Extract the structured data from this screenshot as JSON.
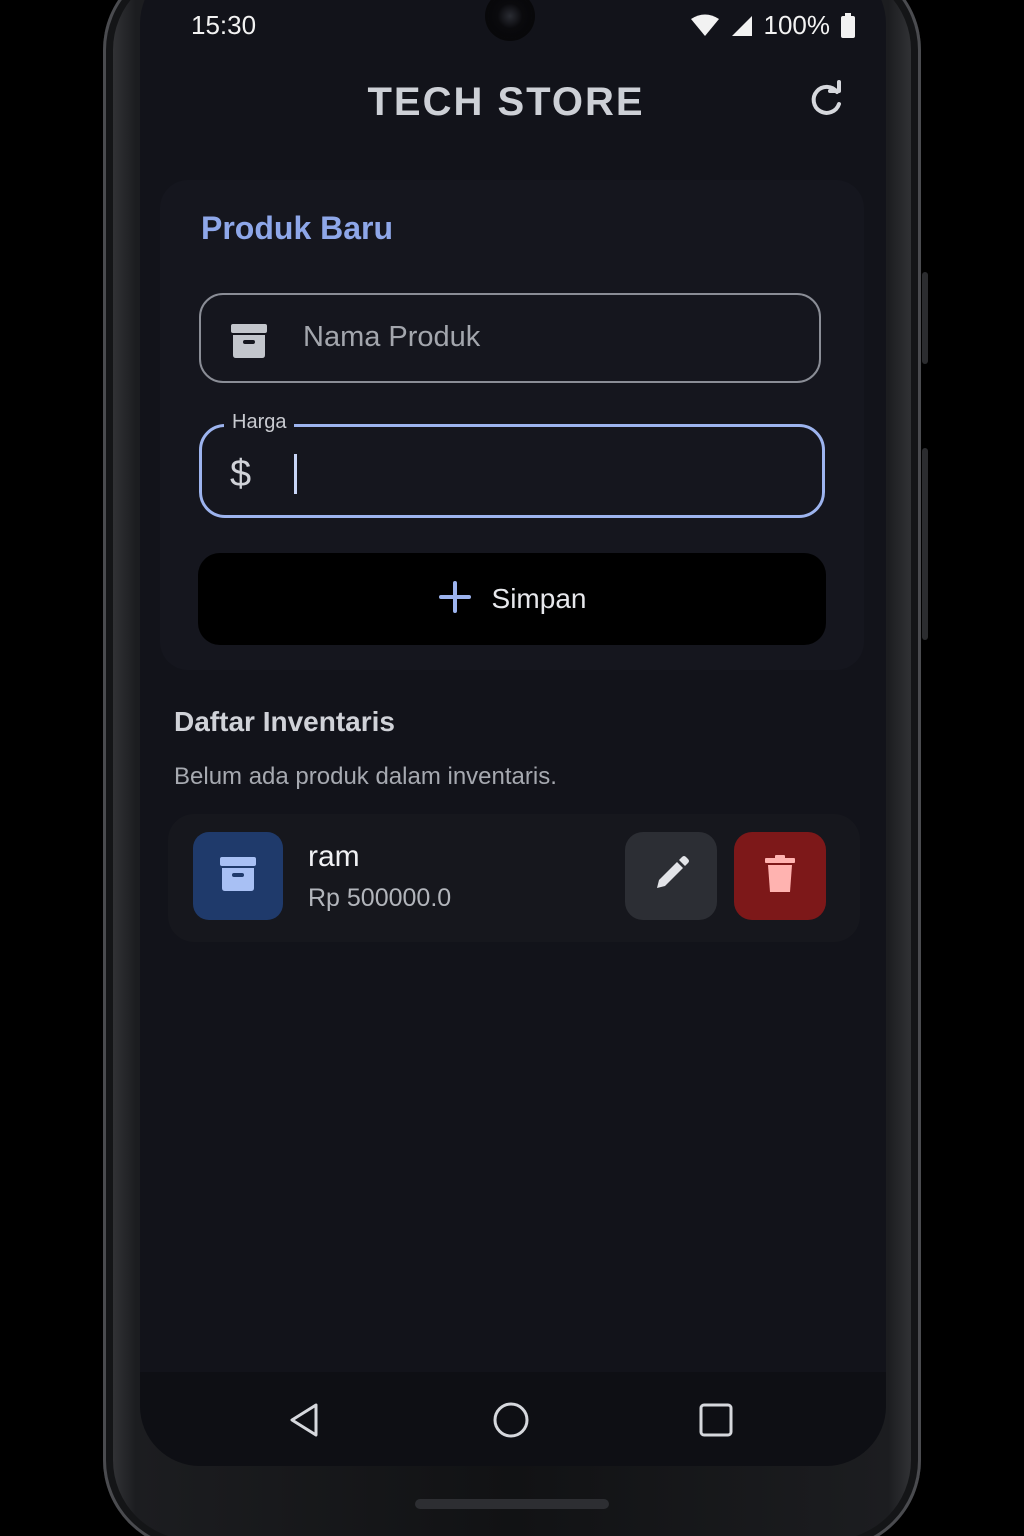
{
  "status_bar": {
    "time": "15:30",
    "battery": "100%"
  },
  "header": {
    "title": "TECH STORE",
    "refresh_icon": "refresh-icon"
  },
  "form": {
    "heading": "Produk Baru",
    "name_field": {
      "placeholder": "Nama Produk",
      "icon": "archive-box-icon"
    },
    "price_field": {
      "label": "Harga",
      "prefix": "$",
      "value": ""
    },
    "save_button": {
      "label": "Simpan",
      "icon": "plus-icon"
    }
  },
  "inventory": {
    "heading": "Daftar Inventaris",
    "empty_message": "Belum ada produk dalam inventaris.",
    "items": [
      {
        "name": "ram",
        "price": "Rp 500000.0",
        "icon": "archive-box-icon",
        "edit_icon": "pencil-icon",
        "delete_icon": "trash-icon"
      }
    ]
  },
  "colors": {
    "accent": "#8ea7e9",
    "focused_border": "#9db4ef",
    "item_icon_bg": "#1f3a6b",
    "delete_bg": "#7d1819",
    "edit_bg": "#2c2e34",
    "background": "#12131a"
  },
  "nav_bar": {
    "back_icon": "triangle-back-icon",
    "home_icon": "circle-home-icon",
    "recent_icon": "square-recents-icon"
  }
}
